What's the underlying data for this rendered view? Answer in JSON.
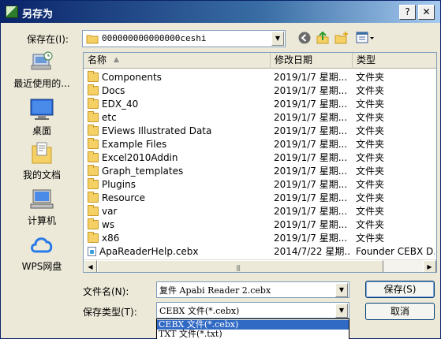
{
  "window": {
    "title": "另存为",
    "help_glyph": "?",
    "close_glyph": "✕"
  },
  "save_in": {
    "label": "保存在(I):",
    "value": "000000000000000ceshi"
  },
  "places": [
    {
      "label": "最近使用的...",
      "icon": "recent-icon"
    },
    {
      "label": "桌面",
      "icon": "desktop-icon"
    },
    {
      "label": "我的文档",
      "icon": "my-documents-icon"
    },
    {
      "label": "计算机",
      "icon": "computer-icon"
    },
    {
      "label": "WPS网盘",
      "icon": "cloud-icon"
    }
  ],
  "columns": {
    "name": "名称",
    "date": "修改日期",
    "type": "类型"
  },
  "files": [
    {
      "name": "Components",
      "date": "2019/1/7 星期...",
      "type": "文件夹",
      "kind": "folder"
    },
    {
      "name": "Docs",
      "date": "2019/1/7 星期...",
      "type": "文件夹",
      "kind": "folder"
    },
    {
      "name": "EDX_40",
      "date": "2019/1/7 星期...",
      "type": "文件夹",
      "kind": "folder"
    },
    {
      "name": "etc",
      "date": "2019/1/7 星期...",
      "type": "文件夹",
      "kind": "folder"
    },
    {
      "name": "EViews Illustrated Data",
      "date": "2019/1/7 星期...",
      "type": "文件夹",
      "kind": "folder"
    },
    {
      "name": "Example Files",
      "date": "2019/1/7 星期...",
      "type": "文件夹",
      "kind": "folder"
    },
    {
      "name": "Excel2010Addin",
      "date": "2019/1/7 星期...",
      "type": "文件夹",
      "kind": "folder"
    },
    {
      "name": "Graph_templates",
      "date": "2019/1/7 星期...",
      "type": "文件夹",
      "kind": "folder"
    },
    {
      "name": "Plugins",
      "date": "2019/1/7 星期...",
      "type": "文件夹",
      "kind": "folder"
    },
    {
      "name": "Resource",
      "date": "2019/1/7 星期...",
      "type": "文件夹",
      "kind": "folder"
    },
    {
      "name": "var",
      "date": "2019/1/7 星期...",
      "type": "文件夹",
      "kind": "folder"
    },
    {
      "name": "ws",
      "date": "2019/1/7 星期...",
      "type": "文件夹",
      "kind": "folder"
    },
    {
      "name": "x86",
      "date": "2019/1/7 星期...",
      "type": "文件夹",
      "kind": "folder"
    },
    {
      "name": "ApaReaderHelp.cebx",
      "date": "2014/7/22 星期...",
      "type": "Founder CEBX D...",
      "kind": "file"
    }
  ],
  "filename": {
    "label": "文件名(N):",
    "value": "复件 Apabi Reader 2.cebx"
  },
  "filetype": {
    "label": "保存类型(T):",
    "value": "CEBX 文件(*.cebx)",
    "options": [
      "CEBX 文件(*.cebx)",
      "TXT 文件(*.txt)"
    ],
    "selected_index": 0
  },
  "buttons": {
    "save": "保存(S)",
    "cancel": "取消"
  },
  "colors": {
    "titlebar": "#0a246a",
    "selection": "#316ac5",
    "face": "#ece9d8"
  }
}
